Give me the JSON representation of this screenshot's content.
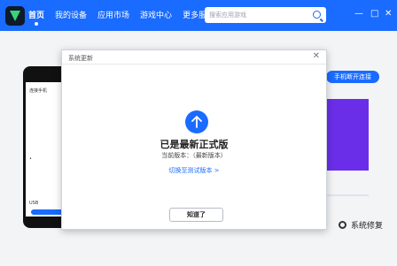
{
  "nav": {
    "items": [
      {
        "label": "首页"
      },
      {
        "label": "我的设备"
      },
      {
        "label": "应用市场"
      },
      {
        "label": "游戏中心"
      },
      {
        "label": "更多服务"
      }
    ]
  },
  "search": {
    "placeholder": "搜索应用游戏"
  },
  "window_controls": {
    "minimize": "—",
    "maximize": "□",
    "close": "✕"
  },
  "background": {
    "connect_button": "手机断开连接",
    "repair_label": "系统修复",
    "phone_lines": [
      "连接手机",
      "•",
      "",
      "",
      "",
      "USB"
    ]
  },
  "dialog": {
    "title": "系统更新",
    "close": "✕",
    "heading": "已是最新正式版",
    "version_text": "当前版本：（最新版本）",
    "switch_link": "切换至测试版本 >",
    "ok_button": "知道了"
  },
  "colors": {
    "accent": "#1a6bff",
    "purple": "#6b2ee8"
  }
}
